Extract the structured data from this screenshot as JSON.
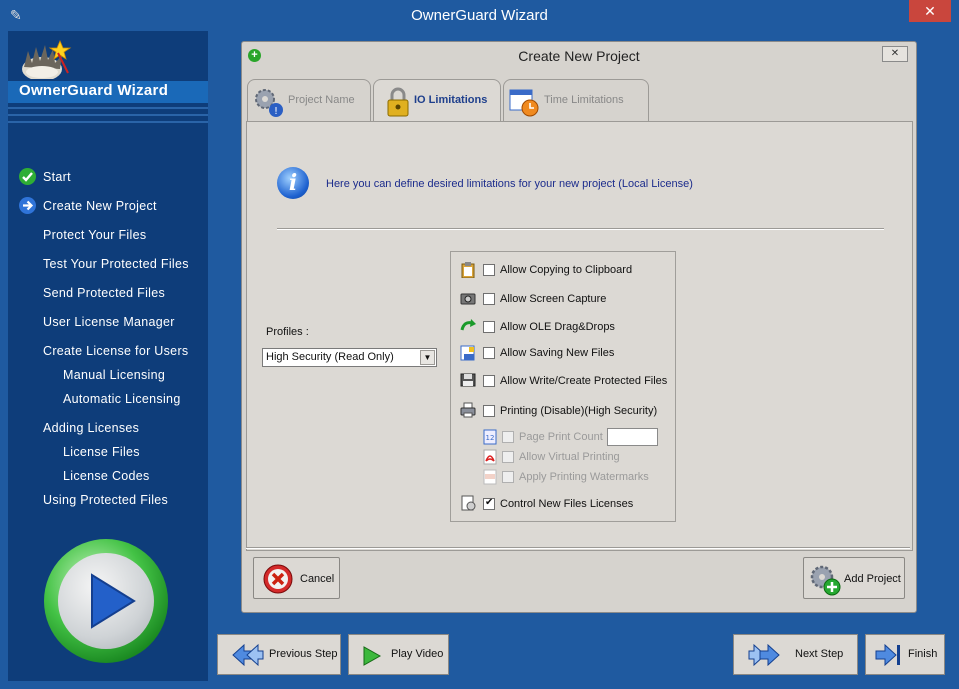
{
  "window": {
    "title": "OwnerGuard Wizard",
    "close_glyph": "✕"
  },
  "sidebar": {
    "title": "OwnerGuard Wizard",
    "items": [
      {
        "label": "Start",
        "icon": "check-circle-icon"
      },
      {
        "label": "Create New Project",
        "icon": "arrow-right-circle-icon"
      },
      {
        "label": "Protect Your Files"
      },
      {
        "label": "Test Your Protected Files"
      },
      {
        "label": "Send Protected Files"
      },
      {
        "label": "User License Manager"
      },
      {
        "label": "Create License for Users"
      },
      {
        "label": "Manual Licensing"
      },
      {
        "label": "Automatic Licensing"
      },
      {
        "label": "Adding Licenses"
      },
      {
        "label": "License Files"
      },
      {
        "label": "License Codes"
      },
      {
        "label": "Using Protected Files"
      }
    ]
  },
  "dialog": {
    "title": "Create New Project",
    "close_glyph": "✕",
    "tabs": [
      {
        "label": "Project Name",
        "icon": "gears-warning-icon"
      },
      {
        "label": "IO Limitations",
        "icon": "lock-icon"
      },
      {
        "label": "Time Limitations",
        "icon": "calendar-clock-icon"
      }
    ],
    "info_text": "Here you can define desired limitations for your new project (Local License)",
    "profiles_label": "Profiles :",
    "profile_selected": "High Security (Read Only)",
    "options": {
      "clipboard": "Allow Copying to Clipboard",
      "screen_capture": "Allow Screen Capture",
      "ole_drag": "Allow OLE Drag&Drops",
      "saving": "Allow Saving New Files",
      "write_protected": "Allow Write/Create Protected Files",
      "printing": "Printing (Disable)(High Security)",
      "page_print_count": "Page Print Count",
      "virtual_printing": "Allow Virtual Printing",
      "watermarks": "Apply Printing Watermarks",
      "control_licenses": "Control New Files Licenses"
    },
    "cancel_label": "Cancel",
    "add_project_label": "Add Project"
  },
  "bottom": {
    "previous": "Previous Step",
    "play_video": "Play Video",
    "next": "Next Step",
    "finish": "Finish"
  },
  "colors": {
    "frame": "#1f5aa0",
    "sidebar": "#0e3d7a",
    "dialog": "#d6d3ce",
    "accent": "#1e3f8c"
  }
}
